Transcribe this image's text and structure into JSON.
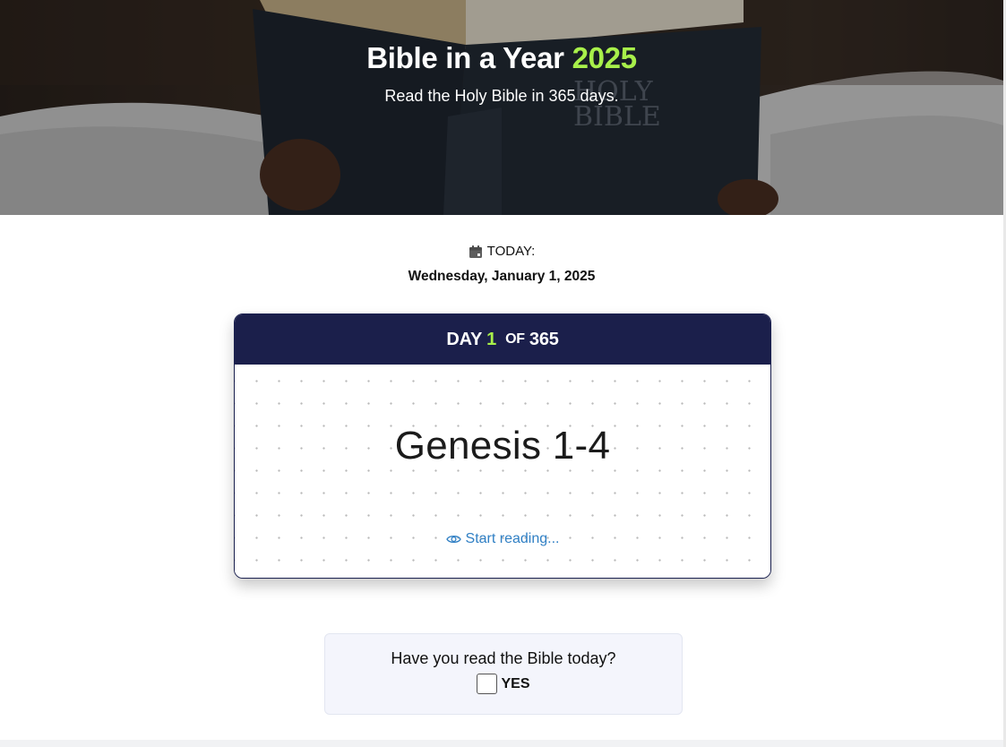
{
  "hero": {
    "title_prefix": "Bible in a Year",
    "title_year": "2025",
    "subtitle": "Read the Holy Bible in 365 days.",
    "image": "person-reading-holy-bible"
  },
  "today": {
    "icon": "calendar-icon",
    "label": "TODAY:",
    "date": "Wednesday, January 1, 2025"
  },
  "day_card": {
    "day_word": "DAY",
    "current_day": "1",
    "of_word": "OF",
    "total_days": "365",
    "reading": "Genesis 1-4",
    "start_icon": "eye-icon",
    "start_label": "Start reading..."
  },
  "confirm": {
    "question": "Have you read the Bible today?",
    "checkbox_label": "YES",
    "checked": false
  },
  "colors": {
    "accent_green": "#a8f04a",
    "header_navy": "#1b1f4b",
    "link_blue": "#2f7fc4",
    "confirm_bg": "#f4f5fc"
  }
}
